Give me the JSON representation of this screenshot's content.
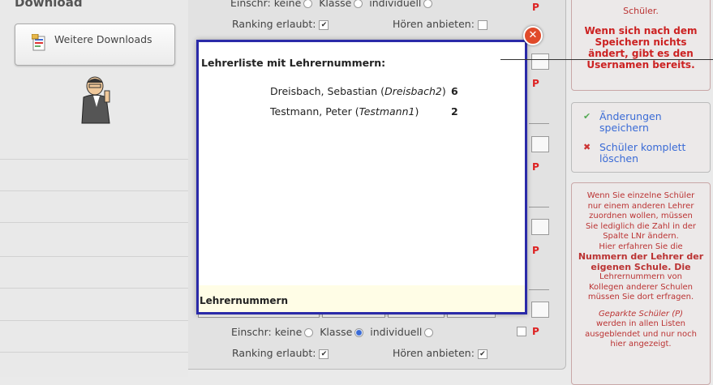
{
  "sidebar": {
    "title": "Download",
    "download_button": "Weitere Downloads",
    "icon": "download-icon",
    "mascot": "teacher-mascot-icon"
  },
  "main": {
    "top_row": {
      "einschr_label": "Einschr: keine",
      "klasse_label": "Klasse",
      "individuell_label": "individuell",
      "p_mark": "P",
      "ranking_label": "Ranking erlaubt:",
      "hoeren_label": "Hören anbieten:"
    },
    "p_marks": [
      "P",
      "P",
      "P",
      "P"
    ],
    "bottom_row": {
      "einschr_label": "Einschr: keine",
      "klasse_label": "Klasse",
      "individuell_label": "individuell",
      "p_mark": "P",
      "ranking_label": "Ranking erlaubt:",
      "hoeren_label": "Hören anbieten:"
    }
  },
  "right": {
    "top_note": "Schüler.",
    "warning": "Wenn sich nach dem Speichern nichts ändert, gibt es den Usernamen bereits.",
    "actions": [
      {
        "mark": "✔",
        "label": "Änderungen speichern",
        "icon": "check-icon"
      },
      {
        "mark": "✖",
        "label": "Schüler komplett löschen",
        "icon": "delete-icon"
      }
    ],
    "info_lines": [
      "Wenn Sie einzelne Schüler",
      "nur einem anderen Lehrer",
      "zuordnen wollen, müssen",
      "Sie lediglich die Zahl in der",
      "Spalte LNr ändern.",
      "Hier erfahren Sie die",
      "Nummern der Lehrer der",
      "eigenen Schule. Die",
      "Lehrernummern von",
      "Kollegen anderer Schulen",
      "müssen Sie dort erfragen.",
      "",
      "Geparkte Schüler (P)",
      "werden in allen Listen",
      "ausgeblendet und nur noch",
      "hier angezeigt."
    ]
  },
  "modal": {
    "title": "Lehrerliste mit Lehrernummern:",
    "teachers": [
      {
        "name": "Dreisbach, Sebastian",
        "user": "Dreisbach2",
        "number": "6"
      },
      {
        "name": "Testmann, Peter",
        "user": "Testmann1",
        "number": "2"
      }
    ],
    "footer": "Lehrernummern",
    "close_label": "✕"
  }
}
